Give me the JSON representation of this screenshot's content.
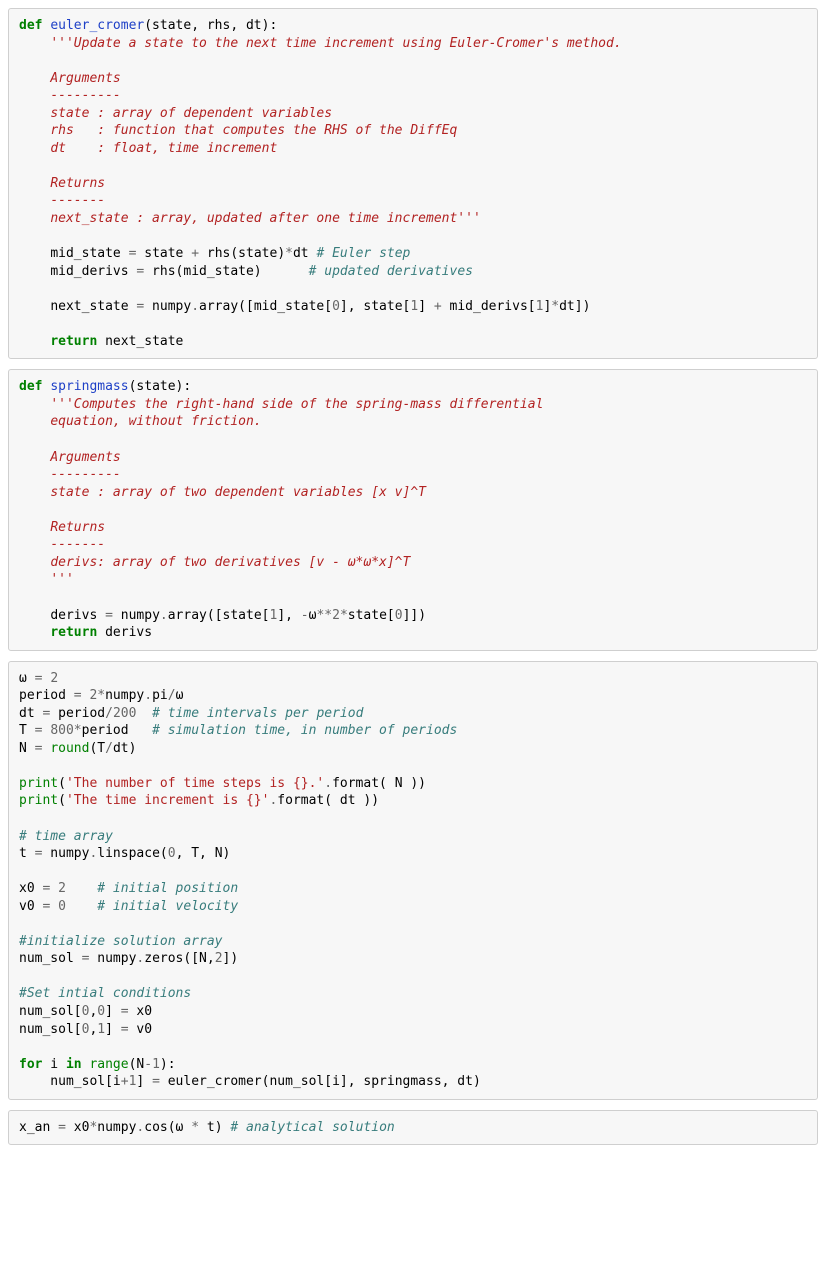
{
  "cell1": {
    "def": "def",
    "fname": "euler_cromer",
    "params": "(state, rhs, dt):",
    "doc1": "'''Update a state to the next time increment using Euler-Cromer's method.",
    "doc2": "Arguments",
    "doc3": "---------",
    "doc4": "state : array of dependent variables",
    "doc5": "rhs   : function that computes the RHS of the DiffEq",
    "doc6": "dt    : float, time increment",
    "doc7": "Returns",
    "doc8": "-------",
    "doc9": "next_state : array, updated after one time increment'''",
    "l1a": "mid_state ",
    "l1op": "=",
    "l1b": " state ",
    "l1op2": "+",
    "l1c": " rhs(state)",
    "l1op3": "*",
    "l1d": "dt ",
    "l1com": "# Euler step",
    "l2a": "mid_derivs ",
    "l2op": "=",
    "l2b": " rhs(mid_state)      ",
    "l2com": "# updated derivatives",
    "l3a": "next_state ",
    "l3op": "=",
    "l3b": " numpy",
    "l3dot": ".",
    "l3c": "array([mid_state[",
    "l3n0": "0",
    "l3d": "], state[",
    "l3n1": "1",
    "l3e": "] ",
    "l3op2": "+",
    "l3f": " mid_derivs[",
    "l3n2": "1",
    "l3g": "]",
    "l3op3": "*",
    "l3h": "dt])",
    "ret": "return",
    "retv": " next_state"
  },
  "cell2": {
    "def": "def",
    "fname": "springmass",
    "params": "(state):",
    "doc1": "'''Computes the right-hand side of the spring-mass differential",
    "doc2": "equation, without friction.",
    "doc3": "Arguments",
    "doc4": "---------",
    "doc5": "state : array of two dependent variables [x v]^T",
    "doc6": "Returns",
    "doc7": "-------",
    "doc8": "derivs: array of two derivatives [v - ω*ω*x]^T",
    "doc9": "'''",
    "l1a": "derivs ",
    "l1op": "=",
    "l1b": " numpy",
    "l1dot": ".",
    "l1c": "array([state[",
    "l1n1": "1",
    "l1d": "], ",
    "l1op2": "-",
    "l1e": "ω",
    "l1op3": "**",
    "l1n2": "2",
    "l1op4": "*",
    "l1f": "state[",
    "l1n0": "0",
    "l1g": "]])",
    "ret": "return",
    "retv": " derivs"
  },
  "cell3": {
    "l1a": "ω ",
    "l1op": "=",
    "l1b": " ",
    "l1n": "2",
    "l2a": "period ",
    "l2op": "=",
    "l2b": " ",
    "l2n": "2",
    "l2op2": "*",
    "l2c": "numpy",
    "l2dot": ".",
    "l2d": "pi",
    "l2op3": "/",
    "l2e": "ω",
    "l3a": "dt ",
    "l3op": "=",
    "l3b": " period",
    "l3op2": "/",
    "l3n": "200",
    "l3sp": "  ",
    "l3com": "# time intervals per period",
    "l4a": "T ",
    "l4op": "=",
    "l4b": " ",
    "l4n": "800",
    "l4op2": "*",
    "l4c": "period   ",
    "l4com": "# simulation time, in number of periods",
    "l5a": "N ",
    "l5op": "=",
    "l5b": " ",
    "l5bi": "round",
    "l5c": "(T",
    "l5op2": "/",
    "l5d": "dt)",
    "l6bi": "print",
    "l6a": "(",
    "l6s": "'The number of time steps is {}.'",
    "l6dot": ".",
    "l6b": "format( N ))",
    "l7bi": "print",
    "l7a": "(",
    "l7s": "'The time increment is {}'",
    "l7dot": ".",
    "l7b": "format( dt ))",
    "l8com": "# time array",
    "l9a": "t ",
    "l9op": "=",
    "l9b": " numpy",
    "l9dot": ".",
    "l9c": "linspace(",
    "l9n0": "0",
    "l9d": ", T, N)",
    "l10a": "x0 ",
    "l10op": "=",
    "l10b": " ",
    "l10n": "2",
    "l10sp": "    ",
    "l10com": "# initial position",
    "l11a": "v0 ",
    "l11op": "=",
    "l11b": " ",
    "l11n": "0",
    "l11sp": "    ",
    "l11com": "# initial velocity",
    "l12com": "#initialize solution array",
    "l13a": "num_sol ",
    "l13op": "=",
    "l13b": " numpy",
    "l13dot": ".",
    "l13c": "zeros([N,",
    "l13n": "2",
    "l13d": "])",
    "l14com": "#Set intial conditions",
    "l15a": "num_sol[",
    "l15n0": "0",
    "l15b": ",",
    "l15n1": "0",
    "l15c": "] ",
    "l15op": "=",
    "l15d": " x0",
    "l16a": "num_sol[",
    "l16n0": "0",
    "l16b": ",",
    "l16n1": "1",
    "l16c": "] ",
    "l16op": "=",
    "l16d": " v0",
    "l17for": "for",
    "l17a": " i ",
    "l17in": "in",
    "l17b": " ",
    "l17bi": "range",
    "l17c": "(N",
    "l17op": "-",
    "l17n": "1",
    "l17d": "):",
    "l18a": "    num_sol[i",
    "l18op": "+",
    "l18n": "1",
    "l18b": "] ",
    "l18op2": "=",
    "l18c": " euler_cromer(num_sol[i], springmass, dt)"
  },
  "cell4": {
    "l1a": "x_an ",
    "l1op": "=",
    "l1b": " x0",
    "l1op2": "*",
    "l1c": "numpy",
    "l1dot": ".",
    "l1d": "cos(ω ",
    "l1op3": "*",
    "l1e": " t) ",
    "l1com": "# analytical solution"
  }
}
